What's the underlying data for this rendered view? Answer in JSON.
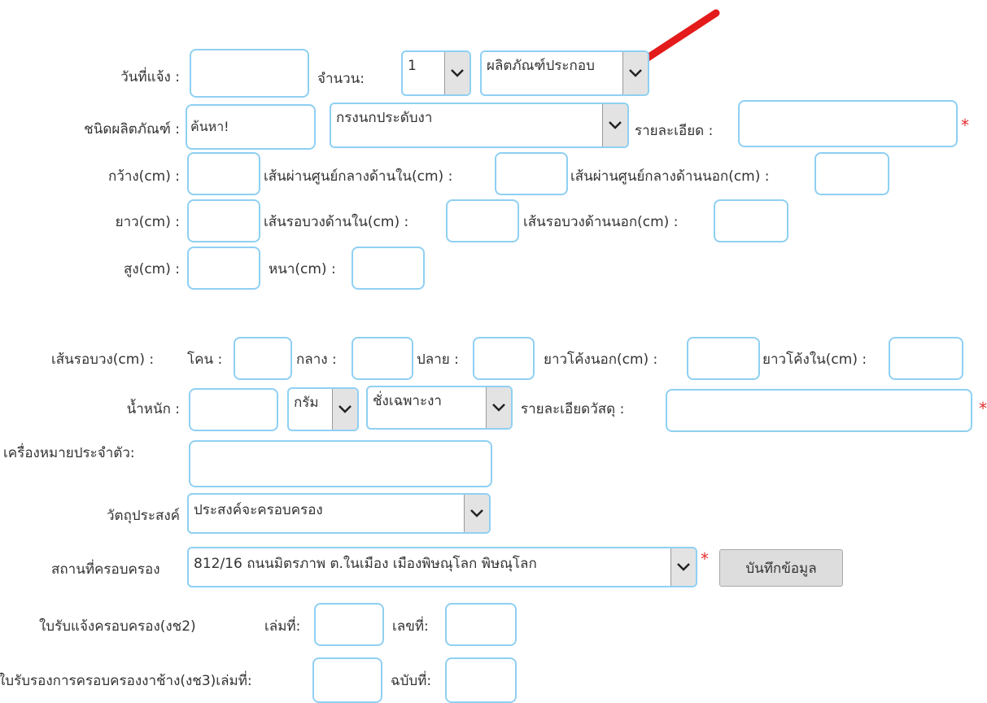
{
  "labels": {
    "report_date": "วันที่แจ้ง :",
    "quantity": "จำนวน:",
    "product_type": "ชนิดผลิตภัณฑ์ :",
    "detail": "รายละเอียด :",
    "width": "กว้าง(cm) :",
    "inner_diameter": "เส้นผ่านศูนย์กลางด้านใน(cm) :",
    "outer_diameter": "เส้นผ่านศูนย์กลางด้านนอก(cm) :",
    "length": "ยาว(cm) :",
    "inner_circumference": "เส้นรอบวงด้านใน(cm) :",
    "outer_circumference": "เส้นรอบวงด้านนอก(cm) :",
    "height": "สูง(cm) :",
    "thickness": "หนา(cm) :",
    "circumference": "เส้นรอบวง(cm) :",
    "base": "โคน :",
    "middle": "กลาง :",
    "tip": "ปลาย :",
    "outer_curve_length": "ยาวโค้งนอก(cm) :",
    "inner_curve_length": "ยาวโค้งใน(cm) :",
    "weight": "น้ำหนัก :",
    "material_detail": "รายละเอียดวัสดุ :",
    "identifying_mark": "เครื่องหมายประจำตัว:",
    "purpose": "วัตถุประสงค์",
    "possession_location": "สถานที่ครอบครอง",
    "receipt_gch2": "ใบรับแจ้งครอบครอง(งช2)",
    "book_no": "เล่มที่:",
    "number": "เลขที่:",
    "certificate_gch3": "ใบรับรองการครอบครองงาช้าง(งช3)เล่มที่:",
    "copy_no": "ฉบับที่:"
  },
  "fields": {
    "search_value": "ค้นหา!",
    "quantity_value": "1",
    "category_value": "ผลิตภัณฑ์ประกอบ",
    "product_type_value": "กรงนกประดับงา",
    "weight_unit_value": "กรัม",
    "weigh_mode_value": "ชั่งเฉพาะงา",
    "purpose_value": "ประสงค์จะครอบครอง",
    "location_value": "812/16 ถนนมิตรภาพ ต.ในเมือง  เมืองพิษณุโลก พิษณุโลก"
  },
  "required_mark": "*",
  "buttons": {
    "save": "บันทึกข้อมูล"
  },
  "colors": {
    "input_border": "#8fd0f2",
    "required": "#e52e2e",
    "annotation_arrow": "#e41b1b"
  }
}
